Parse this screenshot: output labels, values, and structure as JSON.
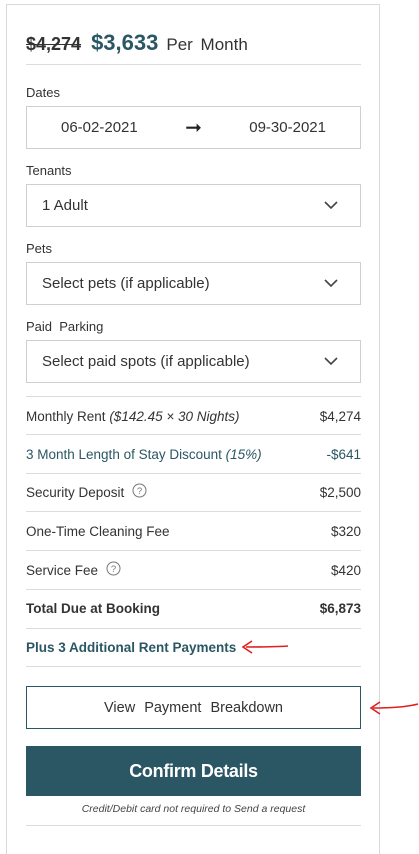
{
  "price": {
    "original": "$4,274",
    "current": "$3,633",
    "period": "Per Month"
  },
  "dates": {
    "label": "Dates",
    "start": "06-02-2021",
    "end": "09-30-2021",
    "arrow": "➞"
  },
  "tenants": {
    "label": "Tenants",
    "value": "1 Adult"
  },
  "pets": {
    "label": "Pets",
    "placeholder": "Select pets (if applicable)"
  },
  "parking": {
    "label": "Paid  Parking",
    "placeholder": "Select paid spots (if applicable)"
  },
  "breakdown": [
    {
      "label": "Monthly Rent",
      "detail": "($142.45 × 30 Nights)",
      "amount": "$4,274"
    },
    {
      "label": "3 Month Length of Stay Discount",
      "detail": "(15%)",
      "amount": "-$641"
    },
    {
      "label": "Security Deposit",
      "amount": "$2,500"
    },
    {
      "label": "One-Time Cleaning Fee",
      "amount": "$320"
    },
    {
      "label": "Service Fee",
      "amount": "$420"
    },
    {
      "label": "Total Due at Booking",
      "amount": "$6,873"
    }
  ],
  "additional_payments": "Plus 3 Additional Rent Payments",
  "view_breakdown_button": "View Payment Breakdown",
  "confirm_button": "Confirm Details",
  "footnote": "Credit/Debit card not required to Send a request",
  "colors": {
    "accent": "#2a5763",
    "annotation": "#e02020",
    "border": "#cfcfcf"
  }
}
